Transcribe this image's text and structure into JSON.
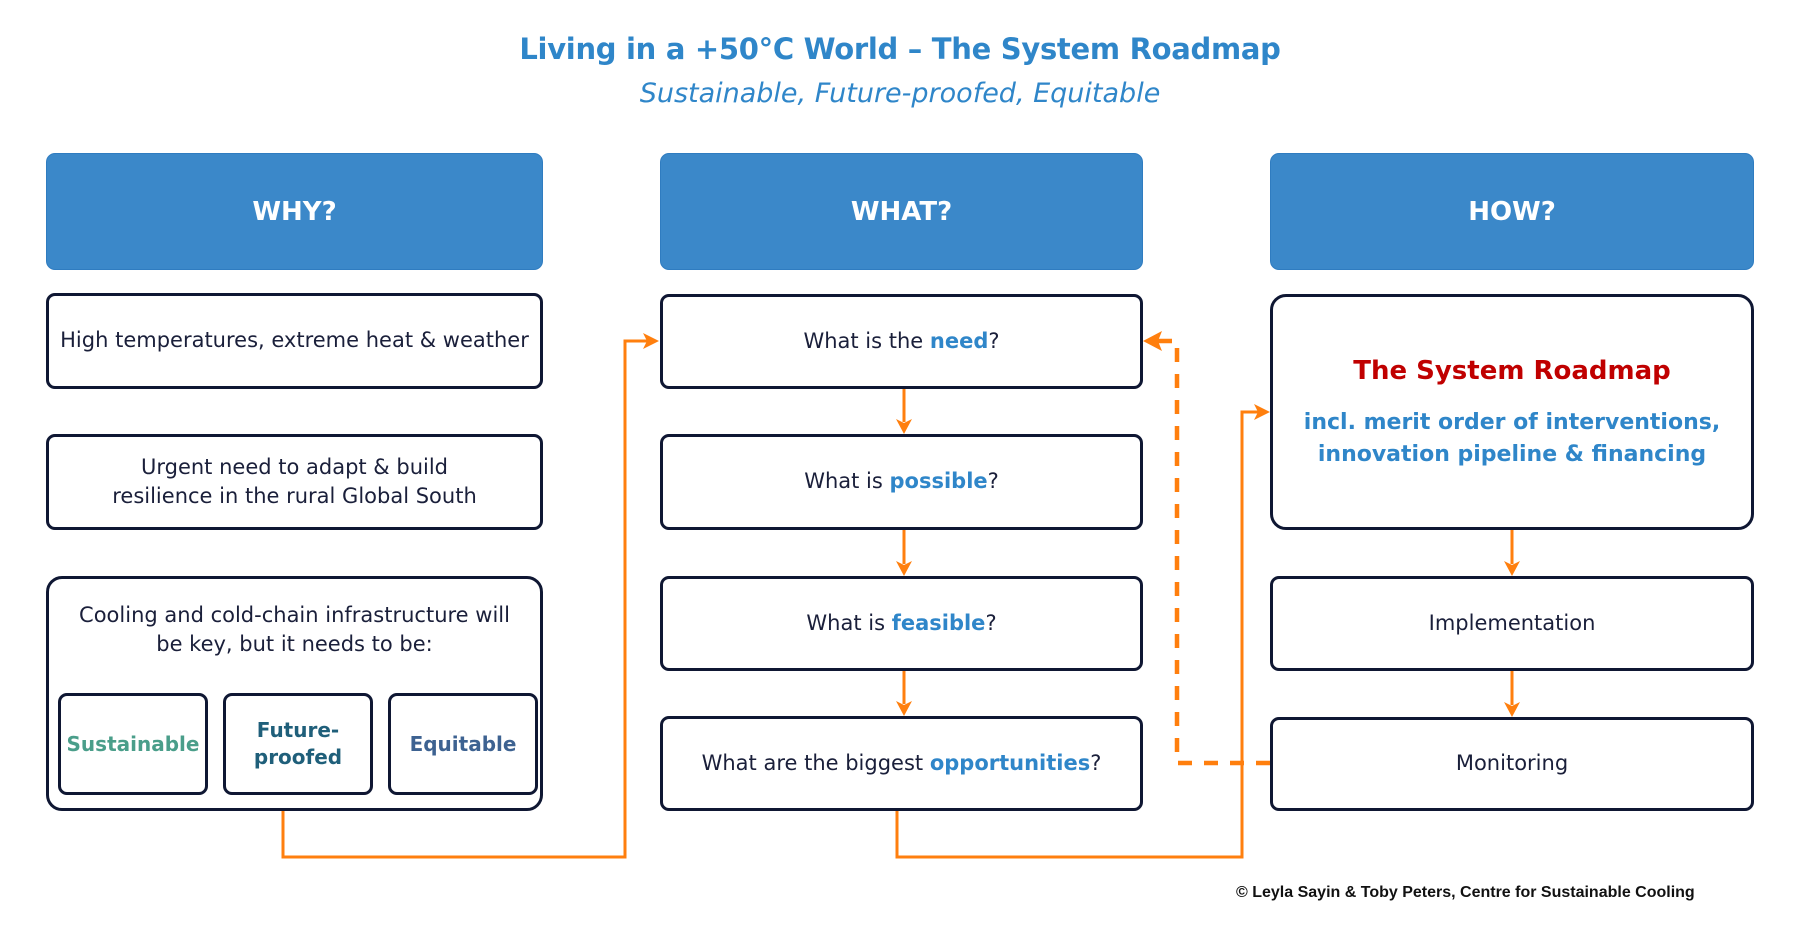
{
  "title": "Living in a +50°C World – The System Roadmap",
  "subtitle": "Sustainable, Future-proofed, Equitable",
  "colors": {
    "header_blue": "#3b88c9",
    "accent_blue": "#2f86c9",
    "roadmap_red": "#c00000",
    "connector_orange": "#ff7f0e",
    "box_border": "#0f1733",
    "sustainable_green": "#4a9e8a",
    "future_proofed_teal": "#1f5f7a",
    "equitable_slate": "#3d6291"
  },
  "columns": {
    "why": {
      "header": "WHY?",
      "boxes": [
        {
          "text": "High temperatures, extreme heat & weather"
        },
        {
          "line1": "Urgent need to adapt & build",
          "line2": "resilience in the rural Global South"
        },
        {
          "line1": "Cooling and cold-chain infrastructure will",
          "line2": "be key, but it needs to be:",
          "qualities": [
            {
              "line1": "Sustainable",
              "line2": ""
            },
            {
              "line1": "Future-",
              "line2": "proofed"
            },
            {
              "line1": "Equitable",
              "line2": ""
            }
          ]
        }
      ]
    },
    "what": {
      "header": "WHAT?",
      "boxes": [
        {
          "prefix": "What is the ",
          "highlight": "need",
          "suffix": "?"
        },
        {
          "prefix": "What is ",
          "highlight": "possible",
          "suffix": "?"
        },
        {
          "prefix": "What is ",
          "highlight": "feasible",
          "suffix": "?"
        },
        {
          "prefix": "What are the biggest ",
          "highlight": "opportunities",
          "suffix": "?"
        }
      ]
    },
    "how": {
      "header": "HOW?",
      "roadmap": {
        "title": "The System Roadmap",
        "desc_line1": "incl. merit order of interventions,",
        "desc_line2": "innovation pipeline & financing"
      },
      "boxes": [
        {
          "text": "Implementation"
        },
        {
          "text": "Monitoring"
        }
      ]
    }
  },
  "connectors": [
    {
      "from": "why-cooling-box",
      "to": "what-need-box",
      "style": "solid"
    },
    {
      "from": "what-need-box",
      "to": "what-possible-box",
      "style": "solid"
    },
    {
      "from": "what-possible-box",
      "to": "what-feasible-box",
      "style": "solid"
    },
    {
      "from": "what-feasible-box",
      "to": "what-opportunities-box",
      "style": "solid"
    },
    {
      "from": "what-opportunities-box",
      "to": "how-roadmap-box",
      "style": "solid"
    },
    {
      "from": "how-roadmap-box",
      "to": "how-implementation-box",
      "style": "solid"
    },
    {
      "from": "how-implementation-box",
      "to": "how-monitoring-box",
      "style": "solid"
    },
    {
      "from": "how-monitoring-box",
      "to": "what-need-box",
      "style": "dashed"
    }
  ],
  "footer": "© Leyla Sayin & Toby Peters, Centre for Sustainable Cooling"
}
